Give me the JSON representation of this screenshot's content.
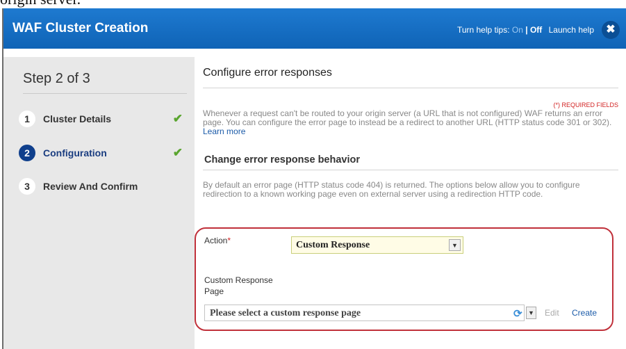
{
  "caption_fragment": "origin server.",
  "window": {
    "title": "WAF Cluster Creation",
    "help_prefix": "Turn help tips:",
    "help_on": "On",
    "help_sep": "|",
    "help_off": "Off",
    "launch_help": "Launch help",
    "close_glyph": "✖"
  },
  "sidebar": {
    "step_title": "Step 2 of 3",
    "steps": [
      {
        "number": "1",
        "label": "Cluster Details",
        "completed": true,
        "active": false
      },
      {
        "number": "2",
        "label": "Configuration",
        "completed": true,
        "active": true
      },
      {
        "number": "3",
        "label": "Review And Confirm",
        "completed": false,
        "active": false
      }
    ],
    "check_glyph": "✔"
  },
  "main": {
    "title": "Configure error responses",
    "required_note": "(*) REQUIRED FIELDS",
    "description": "Whenever a request can't be routed to your origin server (a URL that is not configured) WAF returns an error page. You can configure the error page to instead be a redirect to another URL (HTTP status code 301 or 302).",
    "learn_more": "Learn more",
    "subheading": "Change error response behavior",
    "description2": "By default an error page (HTTP status code 404) is returned. The options below allow you to configure redirection to a known working page even on external server using a redirection HTTP code.",
    "action_label": "Action",
    "required_star": "*",
    "action_value": "Custom Response",
    "custom_response_label": "Custom Response Page",
    "custom_response_placeholder": "Please select a custom response page",
    "edit": "Edit",
    "create": "Create"
  },
  "colors": {
    "titlebar": "#1a72c6",
    "active_step": "#0f3f8c",
    "check": "#5aa52f",
    "highlight": "#c0303a",
    "link": "#1a5aa8"
  },
  "icons": [
    "close-icon",
    "checkmark-icon",
    "chevron-down-icon",
    "refresh-icon"
  ]
}
